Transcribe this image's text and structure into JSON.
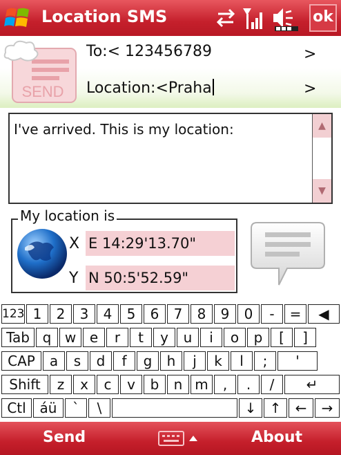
{
  "titlebar": {
    "title": "Location SMS",
    "ok_label": "ok",
    "icons": [
      "windows-start-icon",
      "sync-arrows-icon",
      "signal-icon",
      "volume-mute-icon",
      "battery-icon"
    ]
  },
  "header": {
    "to_label": "To:< 123456789",
    "to_arrow": ">",
    "location_label": "Location:<Praha",
    "location_arrow": ">",
    "send_logo_text": "SEND"
  },
  "message": {
    "text": "I've arrived. This is my location:"
  },
  "location_group": {
    "legend": "My location is",
    "x_label": "X",
    "x_value": "E 14:29'13.70\"",
    "y_label": "Y",
    "y_value": "N 50:5'52.59\""
  },
  "keyboard": {
    "row1": [
      "123",
      "1",
      "2",
      "3",
      "4",
      "5",
      "6",
      "7",
      "8",
      "9",
      "0",
      "-",
      "=",
      "◀"
    ],
    "row2": [
      "Tab",
      "q",
      "w",
      "e",
      "r",
      "t",
      "y",
      "u",
      "i",
      "o",
      "p",
      "[",
      "]"
    ],
    "row3": [
      "CAP",
      "a",
      "s",
      "d",
      "f",
      "g",
      "h",
      "j",
      "k",
      "l",
      ";",
      "'"
    ],
    "row4": [
      "Shift",
      "z",
      "x",
      "c",
      "v",
      "b",
      "n",
      "m",
      ",",
      ".",
      "/",
      "↵"
    ],
    "row5": [
      "Ctl",
      "áü",
      "`",
      "\\",
      "",
      "↓",
      "↑",
      "←",
      "→"
    ]
  },
  "softkeys": {
    "left": "Send",
    "right": "About"
  },
  "colors": {
    "accent_red": "#c5202c",
    "field_pink": "#f5d0d4"
  }
}
